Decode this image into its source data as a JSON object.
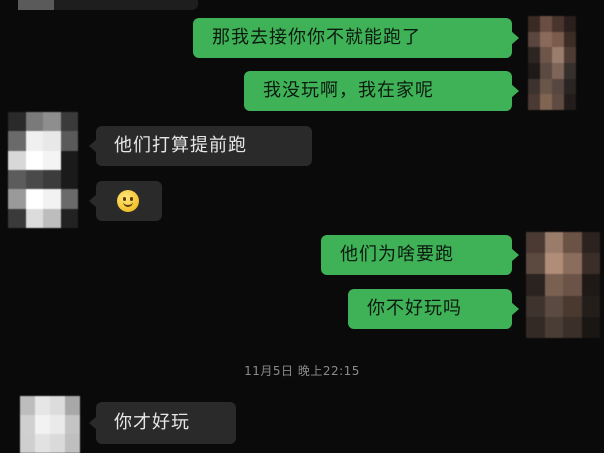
{
  "messages": [
    {
      "id": "m1",
      "direction": "out",
      "text": "那我去接你你不就能跑了"
    },
    {
      "id": "m2",
      "direction": "out",
      "text": "我没玩啊，我在家呢"
    },
    {
      "id": "m3",
      "direction": "in",
      "text": "他们打算提前跑"
    },
    {
      "id": "m4",
      "direction": "in",
      "text": "",
      "emoji": "smile-emoji-icon"
    },
    {
      "id": "m5",
      "direction": "out",
      "text": "他们为啥要跑"
    },
    {
      "id": "m6",
      "direction": "out",
      "text": "你不好玩吗"
    },
    {
      "id": "m7",
      "direction": "in",
      "text": "你才好玩"
    }
  ],
  "timestamp": "11月5日 晚上22:15",
  "colors": {
    "background": "#0a0a0a",
    "outgoing_bubble": "#3fb257",
    "incoming_bubble": "#2a2a2a"
  }
}
